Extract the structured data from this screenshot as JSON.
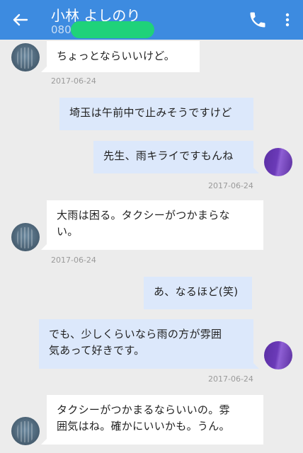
{
  "header": {
    "title": "小林 よしのり",
    "subtitle": "080",
    "back_icon": "back-arrow-icon",
    "phone_icon": "phone-icon",
    "more_icon": "more-vert-icon"
  },
  "colors": {
    "appbar": "#3d8be0",
    "incoming_bubble": "#ffffff",
    "outgoing_bubble": "#dce8fb",
    "background": "#ececec",
    "redaction": "#1fd27a"
  },
  "messages": [
    {
      "direction": "incoming",
      "text": "ちょっとならいいけど。",
      "timestamp": "2017-06-24"
    },
    {
      "direction": "outgoing",
      "text": "埼玉は午前中で止みそうですけど",
      "timestamp": ""
    },
    {
      "direction": "outgoing",
      "text": "先生、雨キライですもんね",
      "timestamp": "2017-06-24"
    },
    {
      "direction": "incoming",
      "text": "大雨は困る。タクシーがつかまらない。",
      "line1": "大雨は困る。タクシーがつかまらな",
      "line2": "い。",
      "timestamp": "2017-06-24"
    },
    {
      "direction": "outgoing",
      "text": "あ、なるほど(笑)",
      "timestamp": ""
    },
    {
      "direction": "outgoing",
      "text": "でも、少しくらいなら雨の方が雰囲気あって好きです。",
      "line1": "でも、少しくらいなら雨の方が雰囲",
      "line2": "気あって好きです。",
      "timestamp": "2017-06-24"
    },
    {
      "direction": "incoming",
      "text": "タクシーがつかまるならいいの。雰囲気はね。確かにいいかも。うん。",
      "line1": "タクシーがつかまるならいいの。雰",
      "line2": "囲気はね。確かにいいかも。うん。",
      "timestamp": ""
    }
  ]
}
